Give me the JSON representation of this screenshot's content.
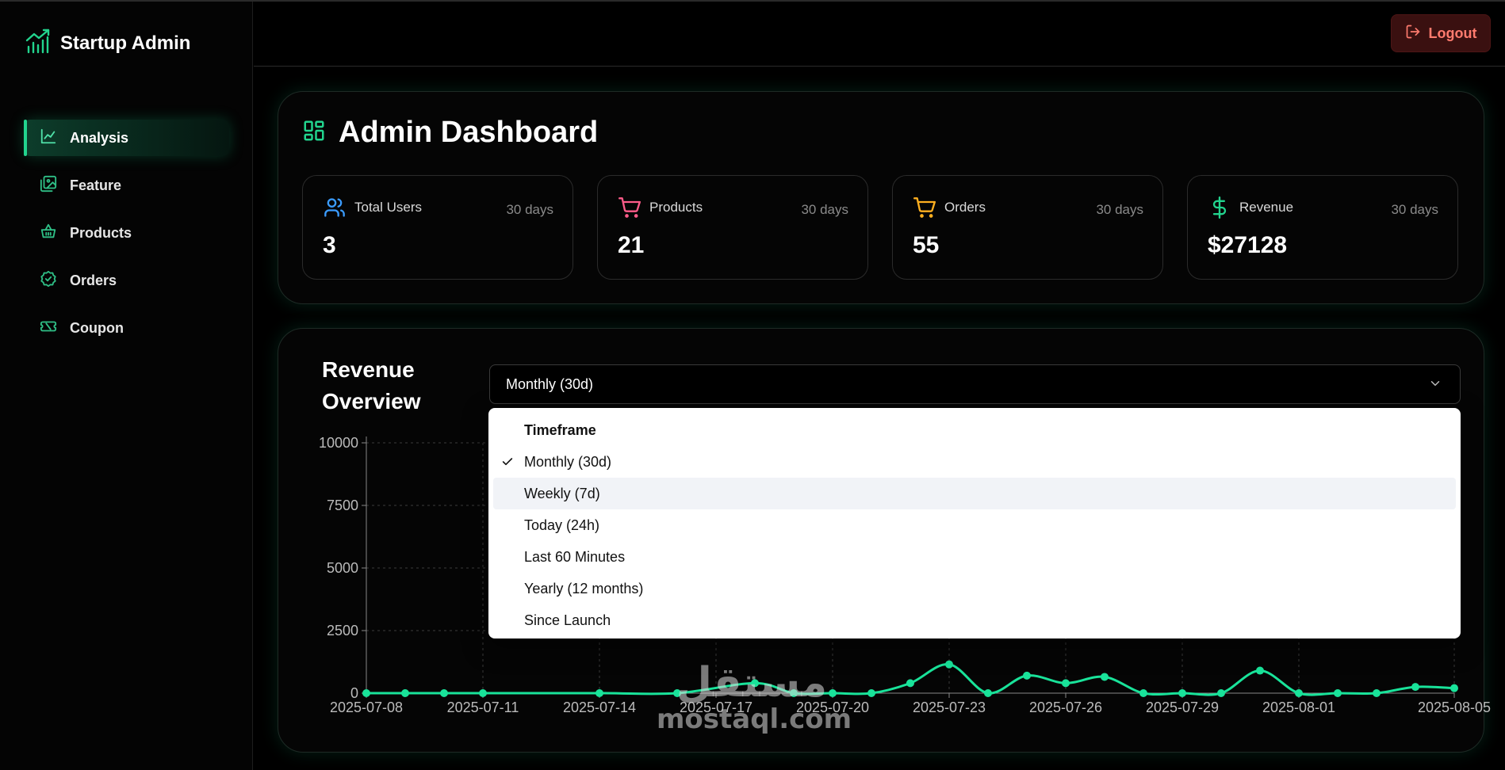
{
  "brand": {
    "title": "Startup Admin",
    "icon": "chart-growth-icon",
    "accent": "#22d48e"
  },
  "sidebar": {
    "items": [
      {
        "label": "Analysis",
        "icon": "line-chart-icon",
        "active": true
      },
      {
        "label": "Feature",
        "icon": "images-icon",
        "active": false
      },
      {
        "label": "Products",
        "icon": "basket-icon",
        "active": false
      },
      {
        "label": "Orders",
        "icon": "badge-check-icon",
        "active": false
      },
      {
        "label": "Coupon",
        "icon": "ticket-icon",
        "active": false
      }
    ]
  },
  "header": {
    "logout_label": "Logout",
    "logout_icon": "log-out-icon",
    "logout_color": "#ff7b6e"
  },
  "dashboard": {
    "title": "Admin Dashboard",
    "title_icon": "layout-dashboard-icon",
    "stats": [
      {
        "label": "Total Users",
        "period": "30 days",
        "value": "3",
        "icon": "users-icon",
        "color": "#3b9cff"
      },
      {
        "label": "Products",
        "period": "30 days",
        "value": "21",
        "icon": "shopping-cart-icon",
        "color": "#ff5c8a"
      },
      {
        "label": "Orders",
        "period": "30 days",
        "value": "55",
        "icon": "shopping-cart-icon",
        "color": "#ffb020"
      },
      {
        "label": "Revenue",
        "period": "30 days",
        "value": "$27128",
        "icon": "dollar-sign-icon",
        "color": "#22d48e"
      }
    ]
  },
  "revenue": {
    "title": "Revenue Overview",
    "selected": "Monthly (30d)",
    "menu": {
      "header": "Timeframe",
      "options": [
        "Monthly (30d)",
        "Weekly (7d)",
        "Today (24h)",
        "Last 60 Minutes",
        "Yearly (12 months)",
        "Since Launch"
      ],
      "selected_index": 0,
      "hover_index": 1
    }
  },
  "chart_data": {
    "type": "line",
    "x": [
      "2025-07-08",
      "2025-07-09",
      "2025-07-10",
      "2025-07-11",
      "2025-07-12",
      "2025-07-13",
      "2025-07-14",
      "2025-07-15",
      "2025-07-16",
      "2025-07-17",
      "2025-07-18",
      "2025-07-19",
      "2025-07-20",
      "2025-07-21",
      "2025-07-22",
      "2025-07-23",
      "2025-07-24",
      "2025-07-25",
      "2025-07-26",
      "2025-07-27",
      "2025-07-28",
      "2025-07-29",
      "2025-07-30",
      "2025-07-31",
      "2025-08-01",
      "2025-08-02",
      "2025-08-03",
      "2025-08-04",
      "2025-08-05"
    ],
    "series": [
      {
        "values": [
          0,
          0,
          0,
          0,
          null,
          null,
          0,
          null,
          0,
          null,
          400,
          0,
          0,
          0,
          400,
          1150,
          0,
          700,
          400,
          650,
          0,
          0,
          0,
          900,
          0,
          0,
          0,
          250,
          200
        ]
      }
    ],
    "x_tick_labels": [
      "2025-07-08",
      "2025-07-11",
      "2025-07-14",
      "2025-07-17",
      "2025-07-20",
      "2025-07-23",
      "2025-07-26",
      "2025-07-29",
      "2025-08-01",
      "2025-08-05"
    ],
    "y_ticks": [
      0,
      2500,
      5000,
      7500,
      10000
    ],
    "ylim": [
      0,
      10000
    ],
    "grid": true,
    "line_color": "#19e39a"
  },
  "watermark": {
    "arabic": "مستقل",
    "latin": "mostaql.com"
  }
}
